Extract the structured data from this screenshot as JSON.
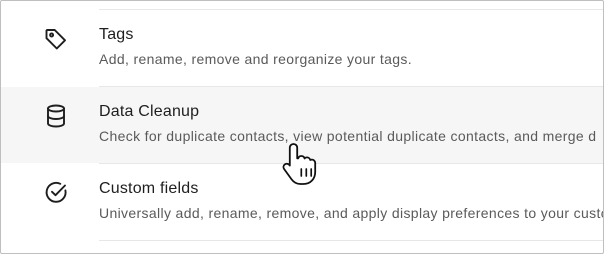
{
  "settings": {
    "items": [
      {
        "title": "Tags",
        "description": "Add, rename, remove and reorganize your tags.",
        "icon": "tag-icon"
      },
      {
        "title": "Data Cleanup",
        "description": "Check for duplicate contacts, view potential duplicate contacts, and merge d",
        "icon": "database-icon"
      },
      {
        "title": "Custom fields",
        "description": "Universally add, rename, remove, and apply display preferences to your custo",
        "icon": "check-circle-icon"
      }
    ]
  },
  "colors": {
    "hover_background": "#f6f6f6",
    "title": "#1e1e1e",
    "description": "#5a5a5a",
    "divider": "#e7e7e7"
  },
  "cursor": "pointer-hand-icon"
}
